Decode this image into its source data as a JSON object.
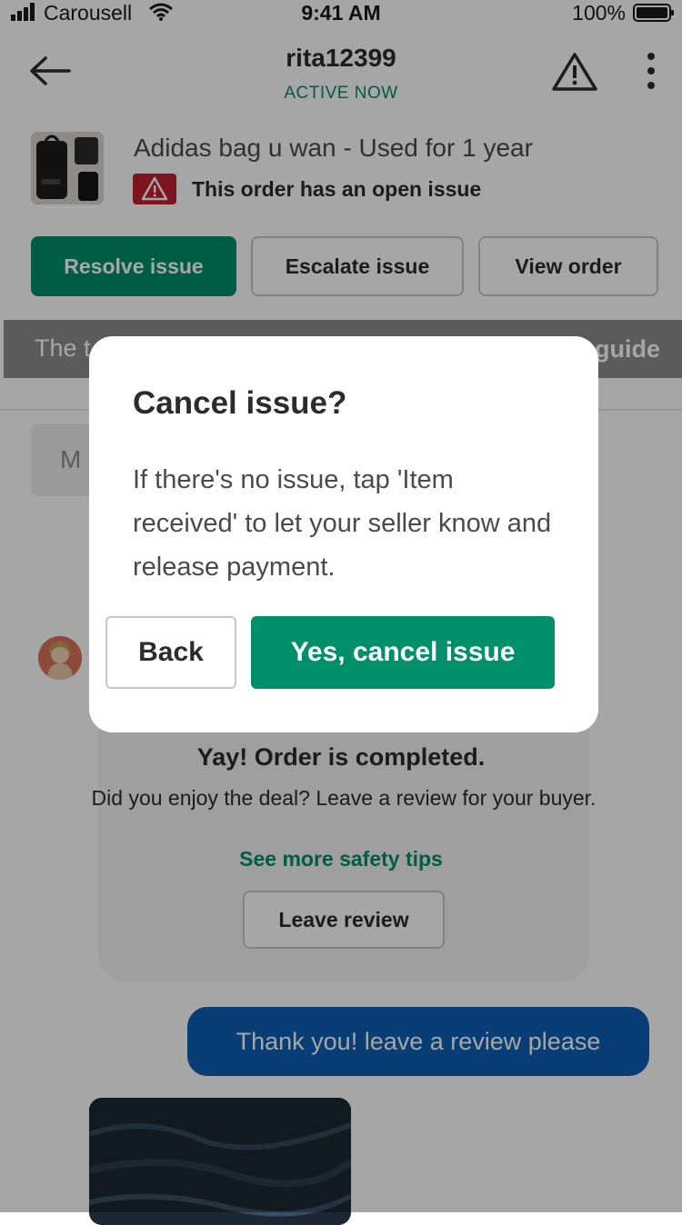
{
  "status_bar": {
    "carrier": "Carousell",
    "time": "9:41 AM",
    "battery": "100%"
  },
  "header": {
    "back_icon": "arrow-left-icon",
    "username": "rita12399",
    "status": "ACTIVE NOW",
    "alert_icon": "warning-triangle-icon",
    "more_icon": "vertical-dots-icon"
  },
  "product": {
    "title": "Adidas bag u wan - Used for 1 year",
    "issue_icon": "warning-triangle-icon",
    "issue_text": "This order has an open issue"
  },
  "actions": {
    "resolve": "Resolve issue",
    "escalate": "Escalate issue",
    "view": "View order"
  },
  "banner": {
    "left_text": "The t",
    "right_text": "guide"
  },
  "message_input_preview": "M",
  "order_card": {
    "title": "Yay! Order is completed.",
    "description": "Did you enjoy the deal? Leave a review for your buyer.",
    "safety_link": "See more safety tips",
    "review_button": "Leave review"
  },
  "chat": {
    "outgoing_message": "Thank you! leave a review please"
  },
  "modal": {
    "title": "Cancel issue?",
    "body": "If there's no issue, tap 'Item received' to let your seller know and release payment.",
    "back_button": "Back",
    "confirm_button": "Yes, cancel issue"
  },
  "colors": {
    "accent": "#008f6b",
    "danger": "#c0212f",
    "bubble": "#0d5eb5",
    "overlay": "rgba(0,0,0,0.35)"
  }
}
